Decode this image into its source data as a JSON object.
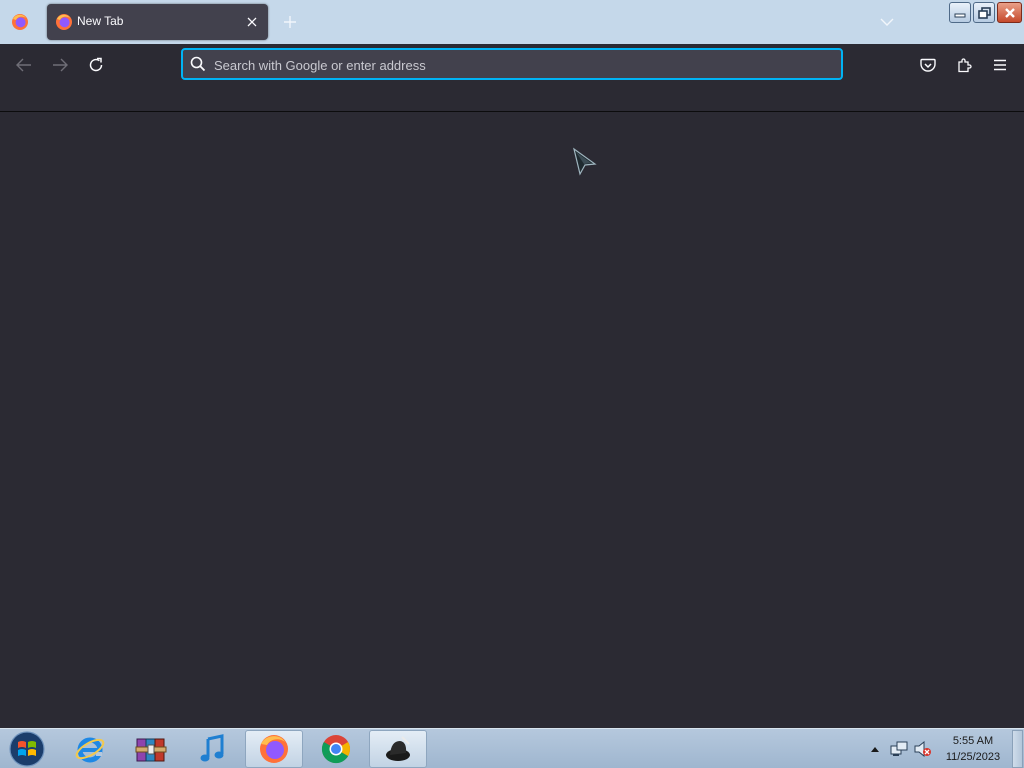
{
  "browser": {
    "tab": {
      "title": "New Tab",
      "icon": "firefox-icon"
    },
    "urlbar": {
      "placeholder": "Search with Google or enter address",
      "value": ""
    },
    "toolbar_icons": [
      "back-arrow-icon",
      "forward-arrow-icon",
      "reload-icon",
      "pocket-icon",
      "extensions-icon",
      "menu-icon"
    ],
    "window_controls": [
      "minimize-icon",
      "restore-icon",
      "close-icon"
    ]
  },
  "taskbar": {
    "apps": [
      {
        "name": "internet-explorer",
        "icon": "internet-explorer-icon",
        "active": false
      },
      {
        "name": "winrar",
        "icon": "winrar-icon",
        "active": false
      },
      {
        "name": "itunes",
        "icon": "itunes-icon",
        "active": false
      },
      {
        "name": "firefox",
        "icon": "firefox-icon",
        "active": true
      },
      {
        "name": "chrome",
        "icon": "chrome-icon",
        "active": false
      },
      {
        "name": "app",
        "icon": "app-icon",
        "active": false
      }
    ],
    "clock": {
      "time": "5:55 AM",
      "date": "11/25/2023"
    }
  },
  "colors": {
    "accent": "#00b3f4",
    "background": "#2b2a33",
    "tab_active": "#42414d",
    "tab_strip": "#c5d8ea"
  }
}
